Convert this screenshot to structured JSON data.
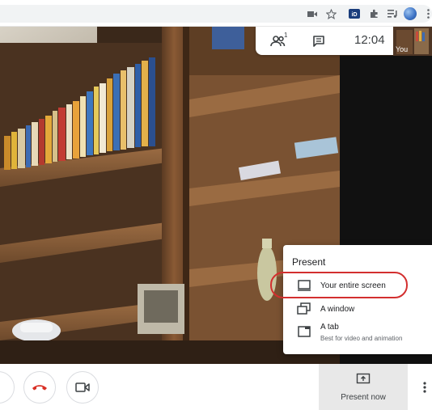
{
  "browser": {
    "icons": [
      "camera-icon",
      "star-icon",
      "extension-id-icon",
      "puzzle-icon",
      "media-queue-icon",
      "profile-avatar",
      "kebab-menu-icon"
    ]
  },
  "meeting_bar": {
    "participant_count": "1",
    "time": "12:04",
    "self_view_label": "You"
  },
  "present_menu": {
    "title": "Present",
    "items": [
      {
        "label": "Your entire screen",
        "icon": "monitor-icon",
        "highlighted": true
      },
      {
        "label": "A window",
        "icon": "window-icon"
      },
      {
        "label": "A tab",
        "sublabel": "Best for video and animation",
        "icon": "tab-icon"
      }
    ],
    "highlight_color": "#d32f2f"
  },
  "controls": {
    "end_call_color": "#d93025",
    "present_now_label": "Present now"
  }
}
